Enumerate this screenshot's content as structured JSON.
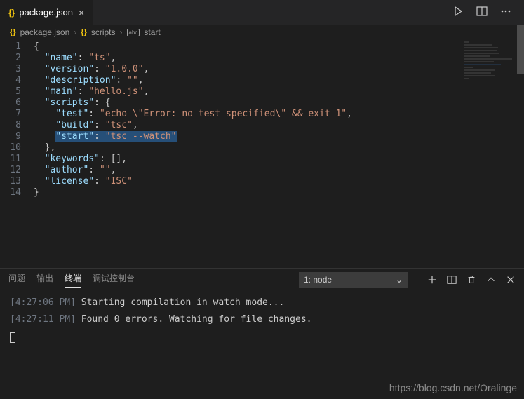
{
  "tab": {
    "icon": "{}",
    "label": "package.json",
    "close": "×"
  },
  "breadcrumb": {
    "icon1": "{}",
    "file": "package.json",
    "icon2": "{}",
    "seg2": "scripts",
    "icon3": "abc",
    "seg3": "start"
  },
  "code": {
    "lines": [
      [
        [
          "punc",
          "{"
        ]
      ],
      [
        [
          "punc",
          "  "
        ],
        [
          "key",
          "\"name\""
        ],
        [
          "punc",
          ": "
        ],
        [
          "str",
          "\"ts\""
        ],
        [
          "punc",
          ","
        ]
      ],
      [
        [
          "punc",
          "  "
        ],
        [
          "key",
          "\"version\""
        ],
        [
          "punc",
          ": "
        ],
        [
          "str",
          "\"1.0.0\""
        ],
        [
          "punc",
          ","
        ]
      ],
      [
        [
          "punc",
          "  "
        ],
        [
          "key",
          "\"description\""
        ],
        [
          "punc",
          ": "
        ],
        [
          "str",
          "\"\""
        ],
        [
          "punc",
          ","
        ]
      ],
      [
        [
          "punc",
          "  "
        ],
        [
          "key",
          "\"main\""
        ],
        [
          "punc",
          ": "
        ],
        [
          "str",
          "\"hello.js\""
        ],
        [
          "punc",
          ","
        ]
      ],
      [
        [
          "punc",
          "  "
        ],
        [
          "key",
          "\"scripts\""
        ],
        [
          "punc",
          ": {"
        ]
      ],
      [
        [
          "punc",
          "    "
        ],
        [
          "key",
          "\"test\""
        ],
        [
          "punc",
          ": "
        ],
        [
          "str",
          "\"echo \\\"Error: no test specified\\\" && exit 1\""
        ],
        [
          "punc",
          ","
        ]
      ],
      [
        [
          "punc",
          "    "
        ],
        [
          "key",
          "\"build\""
        ],
        [
          "punc",
          ": "
        ],
        [
          "str",
          "\"tsc\""
        ],
        [
          "punc",
          ","
        ]
      ],
      [
        [
          "punc",
          "    "
        ],
        [
          "key-sel",
          "\"start\""
        ],
        [
          "punc-sel",
          ": "
        ],
        [
          "str-sel",
          "\"tsc --watch\""
        ]
      ],
      [
        [
          "punc",
          "  },"
        ]
      ],
      [
        [
          "punc",
          "  "
        ],
        [
          "key",
          "\"keywords\""
        ],
        [
          "punc",
          ": [],"
        ]
      ],
      [
        [
          "punc",
          "  "
        ],
        [
          "key",
          "\"author\""
        ],
        [
          "punc",
          ": "
        ],
        [
          "str",
          "\"\""
        ],
        [
          "punc",
          ","
        ]
      ],
      [
        [
          "punc",
          "  "
        ],
        [
          "key",
          "\"license\""
        ],
        [
          "punc",
          ": "
        ],
        [
          "str",
          "\"ISC\""
        ]
      ],
      [
        [
          "punc",
          "}"
        ]
      ]
    ],
    "line_numbers": [
      "1",
      "2",
      "3",
      "4",
      "5",
      "6",
      "7",
      "8",
      "9",
      "10",
      "11",
      "12",
      "13",
      "14"
    ]
  },
  "panel": {
    "tabs": {
      "problems": "问题",
      "output": "输出",
      "terminal": "终端",
      "debug": "调试控制台"
    },
    "active": "terminal",
    "select": "1: node"
  },
  "terminal": {
    "lines": [
      {
        "time": "[4:27:06 PM]",
        "text": " Starting compilation in watch mode..."
      },
      {
        "time": "[4:27:11 PM]",
        "text": " Found 0 errors. Watching for file changes."
      }
    ]
  },
  "watermark": "https://blog.csdn.net/Oralinge"
}
